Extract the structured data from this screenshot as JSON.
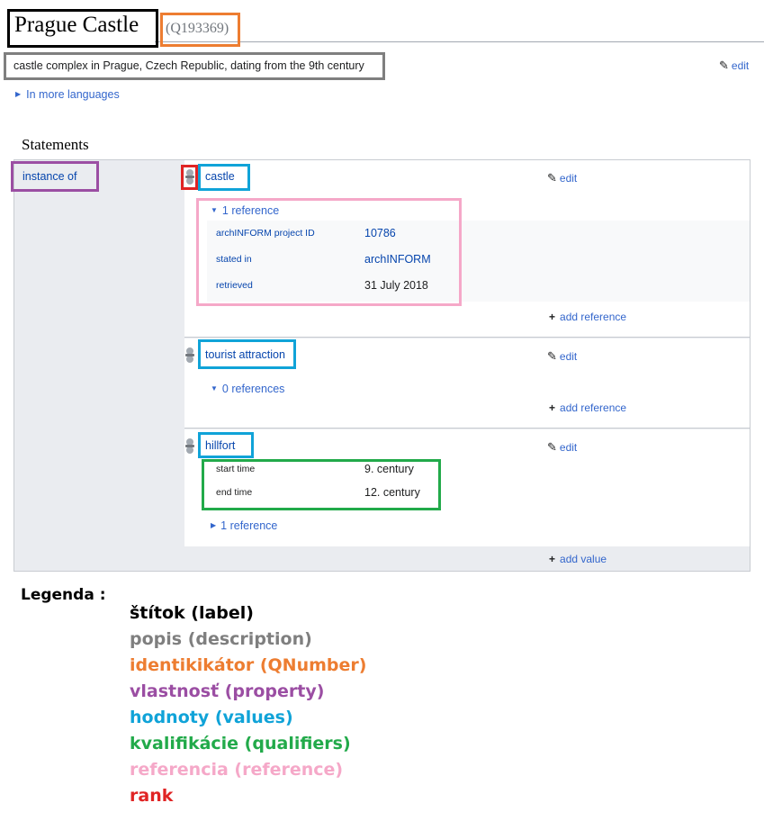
{
  "header": {
    "label": "Prague Castle",
    "qid": "(Q193369)",
    "description": "castle complex in Prague, Czech Republic, dating from the 9th century",
    "edit": "edit",
    "in_more_languages": "In more languages",
    "statements_heading": "Statements"
  },
  "statement_group": {
    "property": "instance of",
    "add_value": "add value",
    "statements": [
      {
        "value": "castle",
        "edit": "edit",
        "references_toggle": "1 reference",
        "reference": [
          {
            "property": "archINFORM project ID",
            "value": "10786"
          },
          {
            "property": "stated in",
            "value": "archINFORM"
          },
          {
            "property": "retrieved",
            "value": "31 July 2018"
          }
        ],
        "add_reference": "add reference"
      },
      {
        "value": "tourist attraction",
        "edit": "edit",
        "references_toggle": "0 references",
        "add_reference": "add reference"
      },
      {
        "value": "hillfort",
        "edit": "edit",
        "qualifiers": [
          {
            "property": "start time",
            "value": "9. century"
          },
          {
            "property": "end time",
            "value": "12. century"
          }
        ],
        "references_toggle": "1 reference"
      }
    ]
  },
  "legend": {
    "title": "Legenda :",
    "items": [
      {
        "text": "štítok (label)",
        "color": "#000000"
      },
      {
        "text": "popis (description)",
        "color": "#7f7f7f"
      },
      {
        "text": "identikikátor (QNumber)",
        "color": "#ed7d31"
      },
      {
        "text": "vlastnosť (property)",
        "color": "#9b4ea3"
      },
      {
        "text": "hodnoty (values)",
        "color": "#10a3d8"
      },
      {
        "text": "kvalifikácie (qualifiers)",
        "color": "#22aa4a"
      },
      {
        "text": "referencia (reference)",
        "color": "#f5a8c8"
      },
      {
        "text": "rank",
        "color": "#e02424"
      }
    ]
  },
  "colors": {
    "label_box": "#000000",
    "description_box": "#7f7f7f",
    "qid_box": "#ed7d31",
    "property_box": "#9b4ea3",
    "value_box": "#10a3d8",
    "qualifier_box": "#22aa4a",
    "reference_box": "#f5a8c8",
    "rank_box": "#e02424",
    "link": "#3366cc",
    "group_bg": "#eaecf0"
  },
  "icons": {
    "edit": "pencil-icon",
    "expand": "triangle-right-icon",
    "collapse": "triangle-down-icon",
    "add": "plus-icon",
    "rank": "rank-normal-icon"
  }
}
